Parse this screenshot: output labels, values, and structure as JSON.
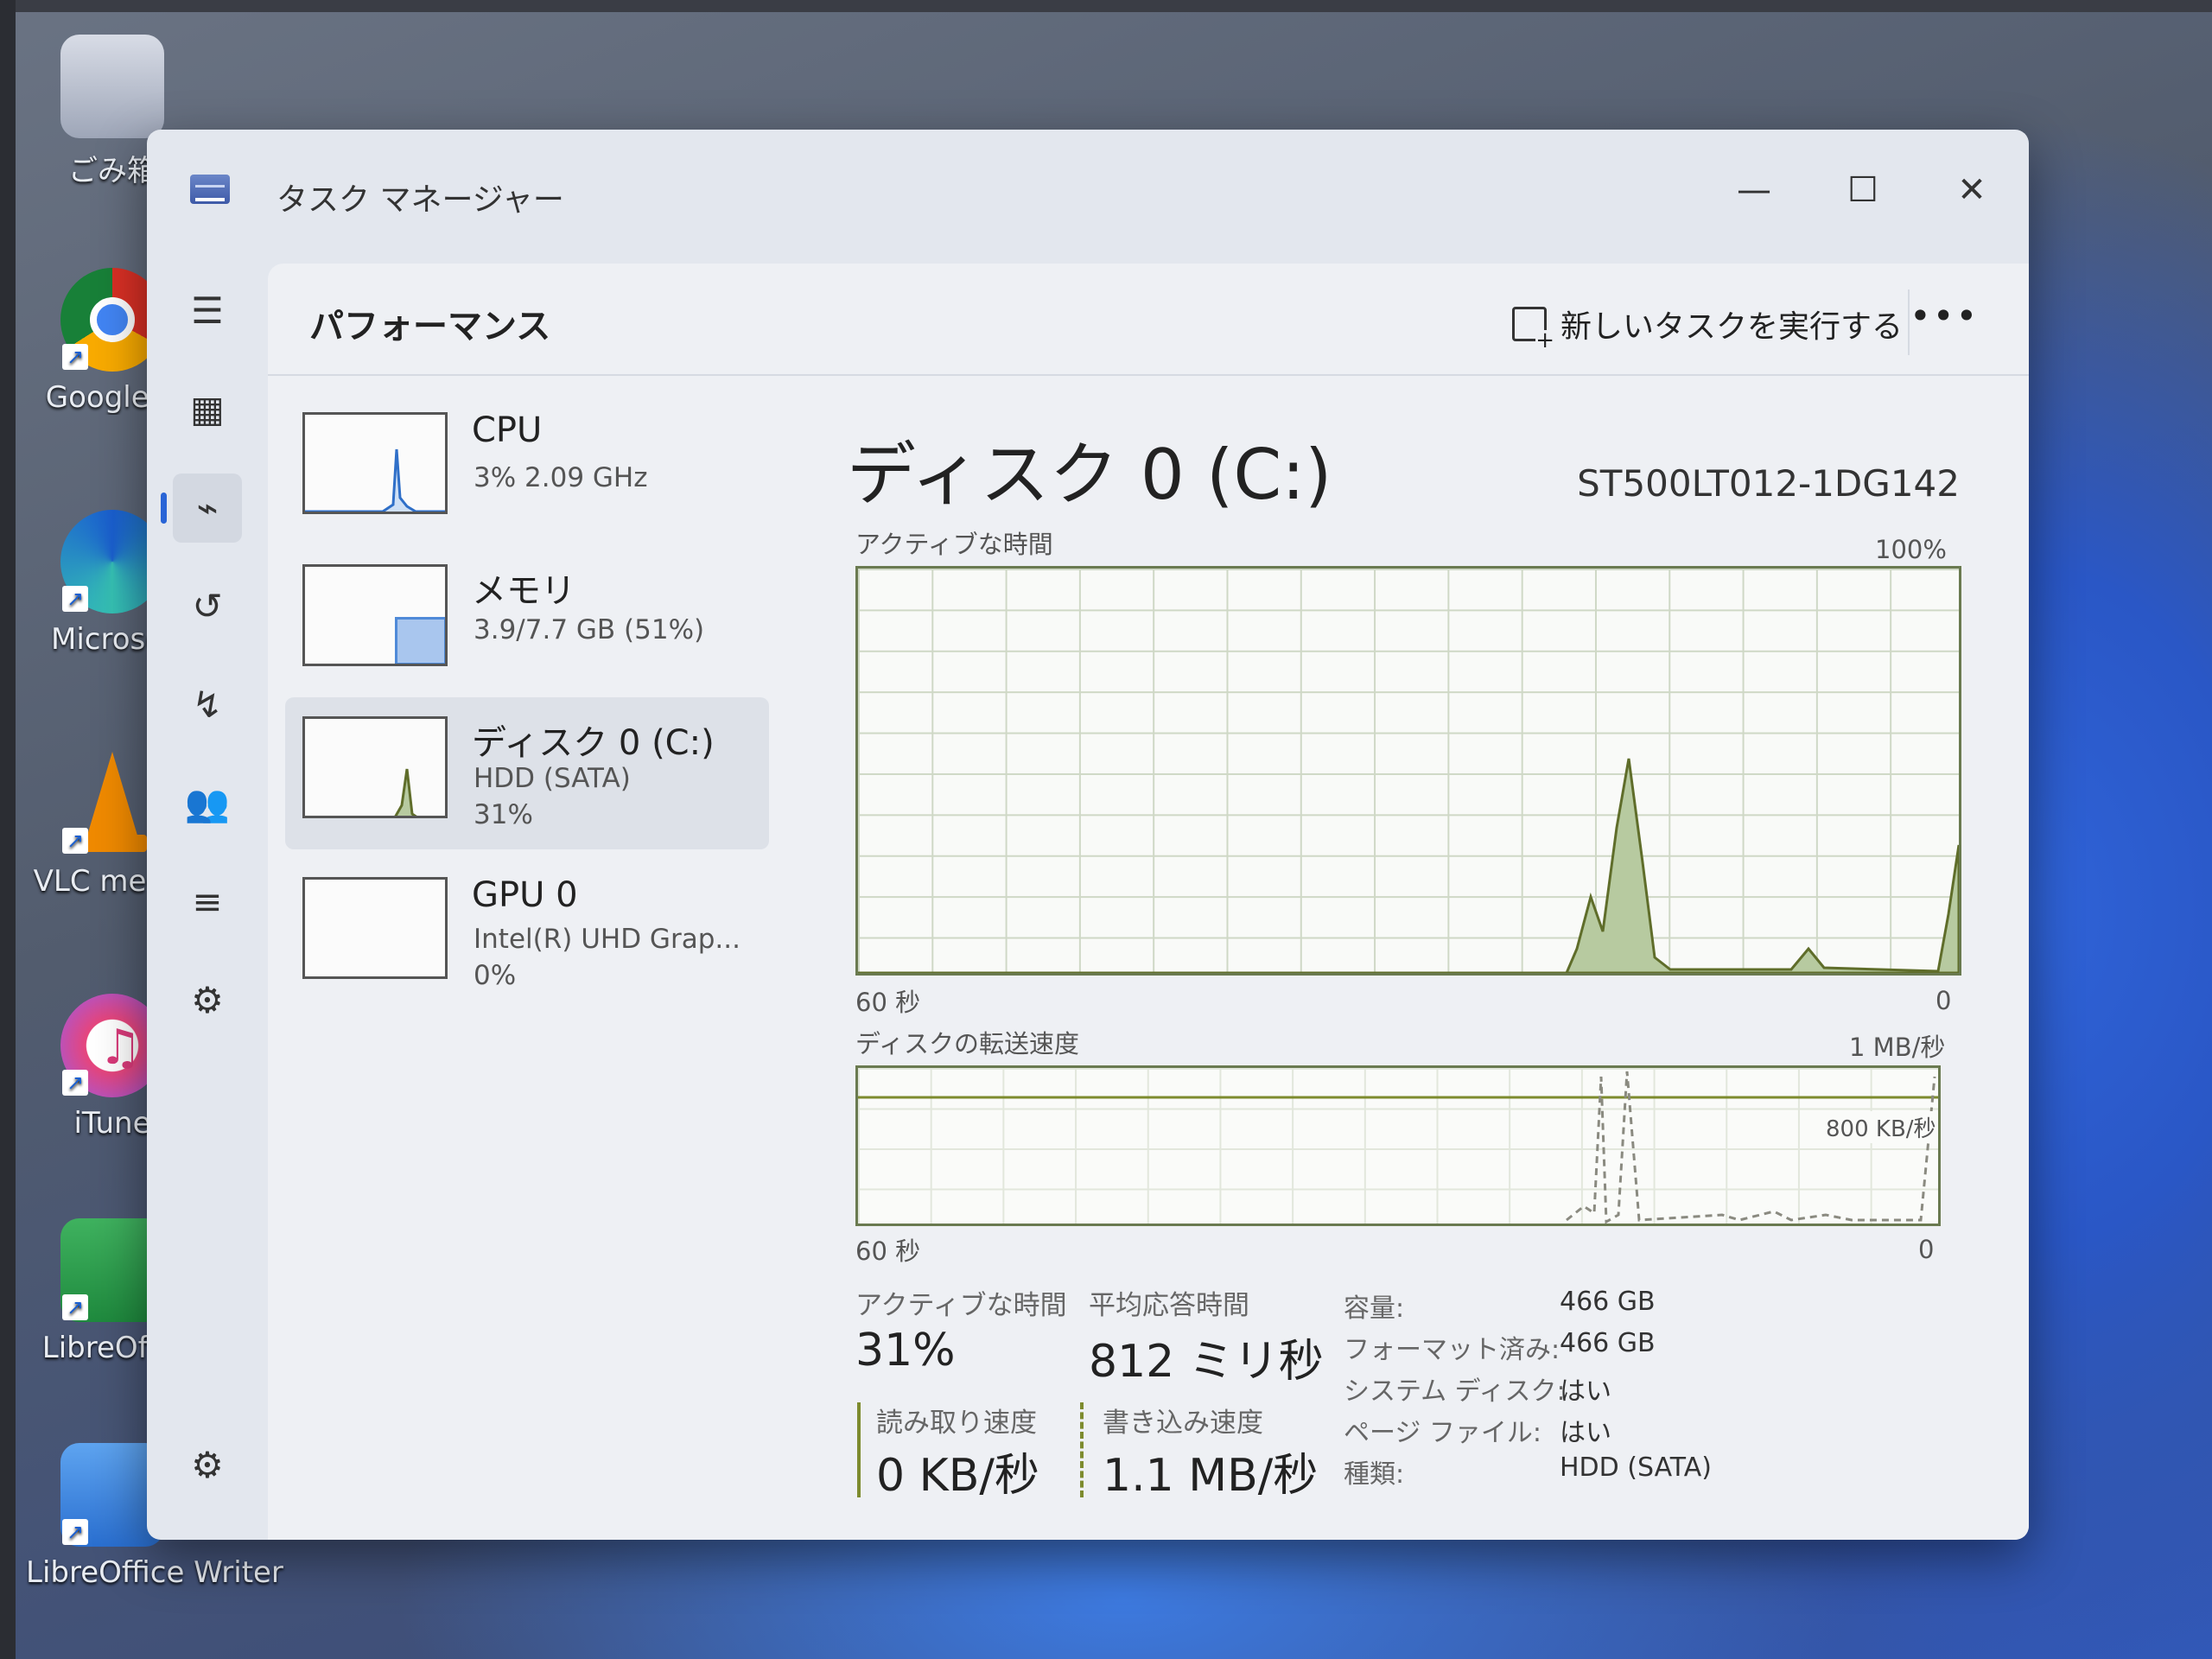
{
  "desktop": {
    "icons": [
      {
        "label": "ごみ箱"
      },
      {
        "label": "Google C"
      },
      {
        "label": "Microsof"
      },
      {
        "label": "VLC media"
      },
      {
        "label": "iTune"
      },
      {
        "label": "LibreOffic"
      },
      {
        "label": "LibreOffice Writer"
      }
    ]
  },
  "window": {
    "title": "タスク マネージャー",
    "controls": {
      "minimize": "—",
      "maximize": "☐",
      "close": "✕"
    }
  },
  "nav": {
    "items": [
      {
        "icon": "hamburger-icon",
        "glyph": "☰"
      },
      {
        "icon": "processes-icon",
        "glyph": "▦"
      },
      {
        "icon": "performance-icon",
        "glyph": "⌁"
      },
      {
        "icon": "history-icon",
        "glyph": "↺"
      },
      {
        "icon": "startup-icon",
        "glyph": "↯"
      },
      {
        "icon": "users-icon",
        "glyph": "👥"
      },
      {
        "icon": "details-icon",
        "glyph": "≡"
      },
      {
        "icon": "services-icon",
        "glyph": "⚙"
      }
    ],
    "settings_glyph": "⚙"
  },
  "header": {
    "title": "パフォーマンス",
    "run_task": "新しいタスクを実行する",
    "more": "•••"
  },
  "resources": [
    {
      "name": "CPU",
      "line1": "3% 2.09 GHz",
      "line2": ""
    },
    {
      "name": "メモリ",
      "line1": "3.9/7.7 GB (51%)",
      "line2": ""
    },
    {
      "name": "ディスク 0 (C:)",
      "line1": "HDD (SATA)",
      "line2": "31%"
    },
    {
      "name": "GPU 0",
      "line1": "Intel(R) UHD Grap...",
      "line2": "0%"
    }
  ],
  "panel": {
    "title": "ディスク 0 (C:)",
    "model": "ST500LT012-1DG142",
    "active_graph": {
      "label": "アクティブな時間",
      "max": "100%",
      "left": "60 秒",
      "right": "0"
    },
    "transfer_graph": {
      "label": "ディスクの転送速度",
      "max": "1 MB/秒",
      "ref_line": "800 KB/秒",
      "left": "60 秒",
      "right": "0"
    },
    "stats": {
      "active_label": "アクティブな時間",
      "active_value": "31%",
      "resp_label": "平均応答時間",
      "resp_value": "812 ミリ秒",
      "read_label": "読み取り速度",
      "read_value": "0 KB/秒",
      "write_label": "書き込み速度",
      "write_value": "1.1 MB/秒"
    },
    "props": [
      {
        "key": "容量:",
        "value": "466 GB"
      },
      {
        "key": "フォーマット済み:",
        "value": "466 GB"
      },
      {
        "key": "システム ディスク:",
        "value": "はい"
      },
      {
        "key": "ページ ファイル:",
        "value": "はい"
      },
      {
        "key": "種類:",
        "value": "HDD (SATA)"
      }
    ]
  },
  "colors": {
    "accent": "#2964d6",
    "disk_green": "#7d8b2e",
    "disk_fill": "#b7caa0",
    "memory_blue": "#4f8ad8"
  }
}
